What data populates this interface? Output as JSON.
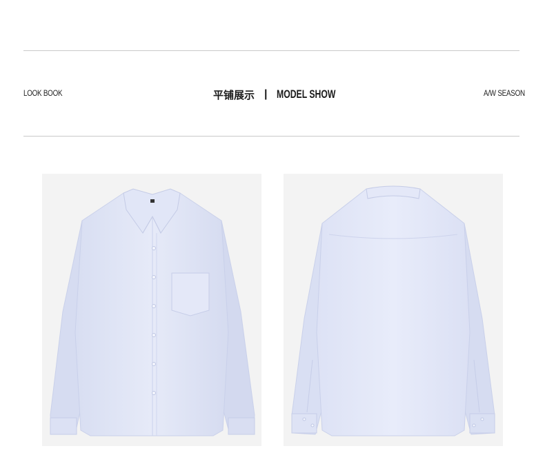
{
  "header": {
    "left_label": "LOOK BOOK",
    "center_chinese": "平铺展示",
    "center_separator": "|",
    "center_english": "MODEL SHOW",
    "right_label": "A/W SEASON"
  },
  "gallery": {
    "items": [
      {
        "icon": "shirt-front-image"
      },
      {
        "icon": "shirt-back-image"
      }
    ],
    "shirt_color": "#dfe4f5",
    "background_color": "#f3f3f3"
  }
}
